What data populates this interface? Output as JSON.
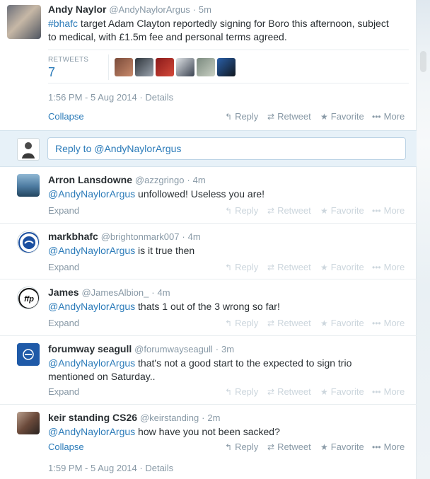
{
  "main_tweet": {
    "fullname": "Andy Naylor",
    "screenname": "@AndyNaylorArgus",
    "dot": "·",
    "time": "5m",
    "hashtag": "#bhafc",
    "text_line1": " target Adam Clayton reportedly signing for Boro this afternoon, subject",
    "text_line2": "to medical, with £1.5m fee and personal terms agreed.",
    "retweets_label": "RETWEETS",
    "retweets_count": "7",
    "timestamp": "1:56 PM - 5 Aug 2014",
    "details": "Details",
    "collapse": "Collapse"
  },
  "actions": {
    "reply": "Reply",
    "retweet": "Retweet",
    "favorite": "Favorite",
    "more": "More"
  },
  "reply_box": {
    "placeholder": "Reply to @AndyNaylorArgus"
  },
  "replies": [
    {
      "fullname": "Arron Lansdowne",
      "screenname": "@azzgringo",
      "time": "4m",
      "mention": "@AndyNaylorArgus",
      "text": " unfollowed! Useless you are!",
      "toggle": "Expand"
    },
    {
      "fullname": "markbhafc",
      "screenname": "@brightonmark007",
      "time": "4m",
      "mention": "@AndyNaylorArgus",
      "text": " is it true then",
      "toggle": "Expand"
    },
    {
      "fullname": "James",
      "screenname": "@JamesAlbion_",
      "time": "4m",
      "mention": "@AndyNaylorArgus",
      "text": " thats 1 out of the 3 wrong so far!",
      "toggle": "Expand",
      "avatar_text": "ffp"
    },
    {
      "fullname": "forumway seagull",
      "screenname": "@forumwayseagull",
      "time": "3m",
      "mention": "@AndyNaylorArgus",
      "text": " that's not a good start to the expected to sign trio",
      "text_line2": "mentioned on Saturday..",
      "toggle": "Expand"
    },
    {
      "fullname": "keir standing CS26",
      "screenname": "@keirstanding",
      "time": "2m",
      "mention": "@AndyNaylorArgus",
      "text": " how have you not been sacked?",
      "toggle": "Collapse",
      "timestamp": "1:59 PM - 5 Aug 2014",
      "details": "Details"
    }
  ],
  "colors": {
    "link": "#2b7bb9",
    "muted": "#8899a6",
    "text": "#292f33",
    "reply_area_bg": "#e7f1f8"
  }
}
